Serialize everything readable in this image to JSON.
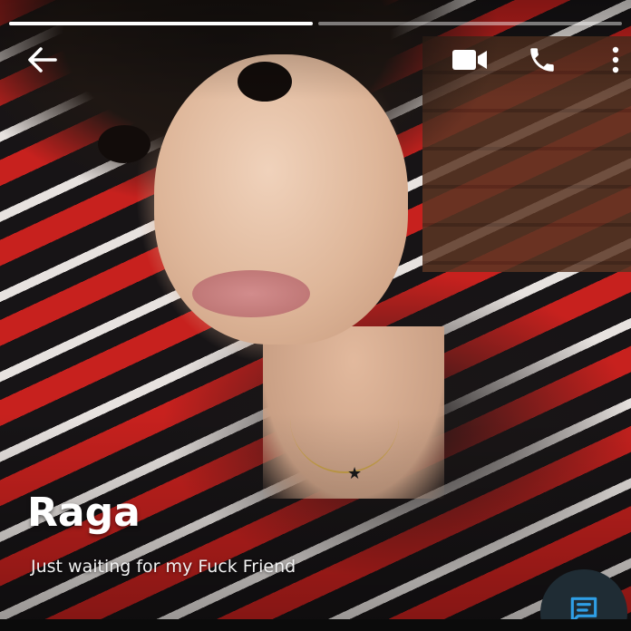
{
  "story": {
    "segments": [
      1.0,
      0.0
    ],
    "colors": {
      "progress_fill": "#ffffff",
      "progress_track": "rgba(255,255,255,0.45)",
      "fab_bg": "#1f2c34",
      "fab_icon": "#2f9fe6"
    }
  },
  "header": {
    "back_icon": "arrow-left-icon",
    "video_icon": "video-camera-icon",
    "phone_icon": "phone-icon",
    "more_icon": "more-vertical-icon"
  },
  "contact": {
    "name": "Raga",
    "status": "Just waiting for my Fuck Friend"
  },
  "fab": {
    "icon": "message-icon"
  }
}
